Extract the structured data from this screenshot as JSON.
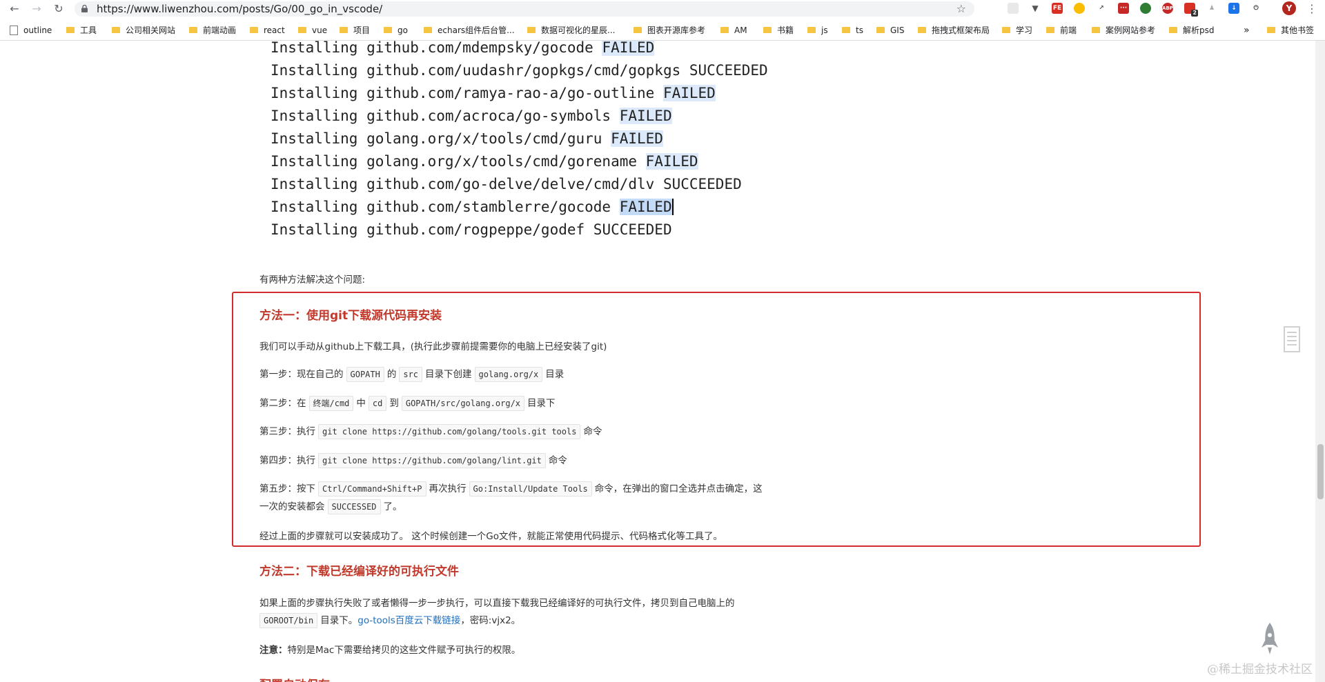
{
  "browser": {
    "url": "https://www.liwenzhou.com/posts/Go/00_go_in_vscode/",
    "bookmarks": [
      "outline",
      "工具",
      "公司相关网站",
      "前端动画",
      "react",
      "vue",
      "项目",
      "go",
      "echars组件后台管...",
      "数据可视化的星辰...",
      "图表开源库参考",
      "AM",
      "书籍",
      "js",
      "ts",
      "GIS",
      "拖拽式框架布局",
      "学习",
      "前端",
      "案例网站参考",
      "解析psd"
    ],
    "bookmark_more": "»",
    "other_bookmarks": "其他书签",
    "avatar_letter": "Y",
    "ext_badge": "2"
  },
  "code_lines": [
    {
      "pre": "Installing github.com/mdempsky/gocode ",
      "status": "FAILED",
      "hl": true
    },
    {
      "pre": "Installing github.com/uudashr/gopkgs/cmd/gopkgs ",
      "status": "SUCCEEDED",
      "hl": false
    },
    {
      "pre": "Installing github.com/ramya-rao-a/go-outline ",
      "status": "FAILED",
      "hl": true
    },
    {
      "pre": "Installing github.com/acroca/go-symbols ",
      "status": "FAILED",
      "hl": true
    },
    {
      "pre": "Installing golang.org/x/tools/cmd/guru ",
      "status": "FAILED",
      "hl": true
    },
    {
      "pre": "Installing golang.org/x/tools/cmd/gorename ",
      "status": "FAILED",
      "hl": true
    },
    {
      "pre": "Installing github.com/go-delve/delve/cmd/dlv ",
      "status": "SUCCEEDED",
      "hl": false
    },
    {
      "pre": "Installing github.com/stamblerre/gocode ",
      "status": "FAILED",
      "hl": true,
      "sel": true
    },
    {
      "pre": "Installing github.com/rogpeppe/godef ",
      "status": "SUCCEEDED",
      "hl": false
    }
  ],
  "intro": "有两种方法解决这个问题:",
  "method1": {
    "title": "方法一：使用git下载源代码再安装",
    "desc": "我们可以手动从github上下载工具，(执行此步骤前提需要你的电脑上已经安装了git)",
    "step1": {
      "a": "第一步：现在自己的",
      "c1": "GOPATH",
      "b": "的",
      "c2": "src",
      "c": "目录下创建",
      "c3": "golang.org/x",
      "d": "目录"
    },
    "step2": {
      "a": "第二步：在",
      "c1": "终端/cmd",
      "b": "中",
      "c2": "cd",
      "c": "到",
      "c3": "GOPATH/src/golang.org/x",
      "d": "目录下"
    },
    "step3": {
      "a": "第三步：执行",
      "c1": "git clone https://github.com/golang/tools.git tools",
      "b": "命令"
    },
    "step4": {
      "a": "第四步：执行",
      "c1": "git clone https://github.com/golang/lint.git",
      "b": "命令"
    },
    "step5": {
      "a": "第五步：按下",
      "c1": "Ctrl/Command+Shift+P",
      "b": "再次执行",
      "c2": "Go:Install/Update Tools",
      "c": "命令，在弹出的窗口全选并点击确定，这",
      "d": "一次的安装都会",
      "c3": "SUCCESSED",
      "e": "了。"
    },
    "result": "经过上面的步骤就可以安装成功了。 这个时候创建一个Go文件，就能正常使用代码提示、代码格式化等工具了。"
  },
  "method2": {
    "title": "方法二：下载已经编译好的可执行文件",
    "p1": "如果上面的步骤执行失败了或者懒得一步一步执行，可以直接下载我已经编译好的可执行文件，拷贝到自己电脑上的",
    "code": "GOROOT/bin",
    "p2": "目录下。",
    "link": "go-tools百度云下载链接",
    "p3": "，密码:vjx2。",
    "note_label": "注意：",
    "note": "特别是Mac下需要给拷贝的这些文件赋予可执行的权限。"
  },
  "next_title_partial": "配置自动保存",
  "watermark": "@稀土掘金技术社区"
}
